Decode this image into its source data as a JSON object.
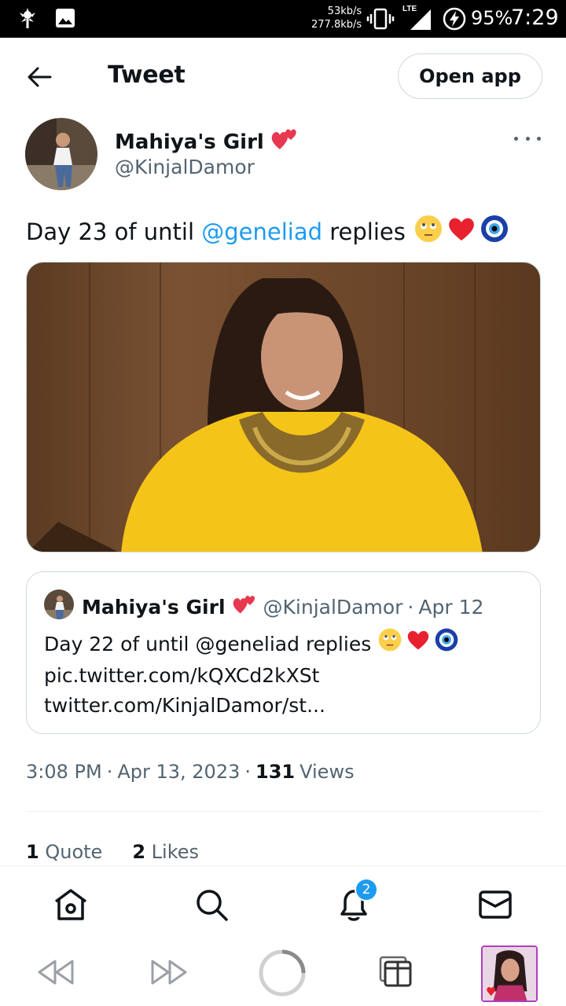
{
  "status_bar": {
    "net_up": "53kb/s",
    "net_down": "277.8kb/s",
    "network_type": "LTE",
    "battery": "95%",
    "time": "7:29"
  },
  "header": {
    "title": "Tweet",
    "open_app_label": "Open app"
  },
  "tweet": {
    "author_name": "Mahiya's Girl",
    "author_handle": "@KinjalDamor",
    "text_prefix": "Day 23 of until ",
    "mention": "@geneliad",
    "text_suffix": " replies",
    "time": "3:08 PM",
    "date": "Apr 13, 2023",
    "views_count": "131",
    "views_label": "Views",
    "quote_count": "1",
    "quote_label": "Quote",
    "likes_count": "2",
    "likes_label": "Likes"
  },
  "quoted_tweet": {
    "author_name": "Mahiya's Girl",
    "author_handle": "@KinjalDamor",
    "separator": "·",
    "date": "Apr 12",
    "text": "Day 22 of until @geneliad replies",
    "link1": "pic.twitter.com/kQXCd2kXSt",
    "link2": "twitter.com/KinjalDamor/st..."
  },
  "tabbar": {
    "notifications_badge": "2"
  },
  "icons": {
    "status_left": [
      "app-notification-icon",
      "image-notification-icon"
    ],
    "tabs": [
      "home-icon",
      "search-icon",
      "notifications-icon",
      "messages-icon"
    ],
    "nav": [
      "back-icon",
      "forward-icon",
      "home-circle-icon",
      "tabs-icon",
      "profile-thumbnail"
    ]
  },
  "colors": {
    "accent": "#1d9bf0",
    "text": "#0f1419",
    "muted": "#536471",
    "border": "#cfd9de"
  }
}
